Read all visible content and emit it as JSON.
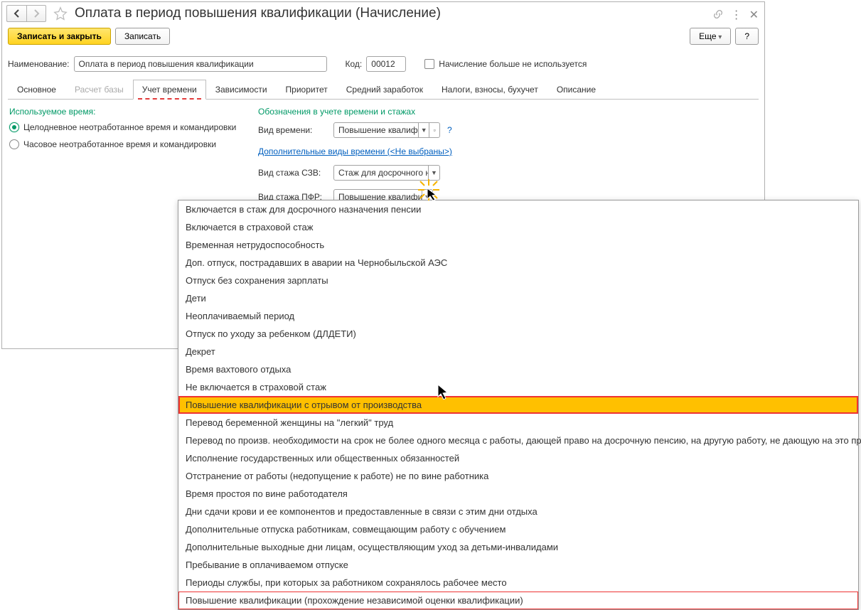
{
  "header": {
    "title": "Оплата в период повышения квалификации (Начисление)"
  },
  "toolbar": {
    "save_close": "Записать и закрыть",
    "save": "Записать",
    "more": "Еще",
    "help": "?"
  },
  "form": {
    "name_label": "Наименование:",
    "name_value": "Оплата в период повышения квалификации",
    "code_label": "Код:",
    "code_value": "00012",
    "not_used_label": "Начисление больше не используется"
  },
  "tabs": [
    {
      "label": "Основное",
      "active": false,
      "disabled": false
    },
    {
      "label": "Расчет базы",
      "active": false,
      "disabled": true
    },
    {
      "label": "Учет времени",
      "active": true,
      "disabled": false
    },
    {
      "label": "Зависимости",
      "active": false,
      "disabled": false
    },
    {
      "label": "Приоритет",
      "active": false,
      "disabled": false
    },
    {
      "label": "Средний заработок",
      "active": false,
      "disabled": false
    },
    {
      "label": "Налоги, взносы, бухучет",
      "active": false,
      "disabled": false
    },
    {
      "label": "Описание",
      "active": false,
      "disabled": false
    }
  ],
  "left": {
    "head": "Используемое время:",
    "radio1": "Целодневное неотработанное время и командировки",
    "radio2": "Часовое неотработанное время и командировки"
  },
  "right": {
    "head": "Обозначения в учете времени и стажах",
    "vid_vremeni_label": "Вид времени:",
    "vid_vremeni_value": "Повышение квалифика",
    "extra_link": "Дополнительные виды времени (<Не выбраны>)",
    "szv_label": "Вид стажа СЗВ:",
    "szv_value": "Стаж для досрочного на",
    "pfr_label": "Вид стажа ПФР:",
    "pfr_value": "Повышение квалифика"
  },
  "dropdown": [
    {
      "text": "Включается в стаж для досрочного назначения пенсии"
    },
    {
      "text": "Включается в страховой стаж"
    },
    {
      "text": "Временная нетрудоспособность"
    },
    {
      "text": "Доп. отпуск, пострадавших в аварии на Чернобыльской АЭС"
    },
    {
      "text": "Отпуск без сохранения зарплаты"
    },
    {
      "text": "Дети"
    },
    {
      "text": "Неоплачиваемый период"
    },
    {
      "text": "Отпуск по уходу за ребенком (ДЛДЕТИ)"
    },
    {
      "text": "Декрет"
    },
    {
      "text": "Время вахтового отдыха"
    },
    {
      "text": "Не включается в страховой стаж"
    },
    {
      "text": "Повышение квалификации с отрывом от производства",
      "highlight": true
    },
    {
      "text": "Перевод беременной женщины на \"легкий\" труд"
    },
    {
      "text": "Перевод по произв. необходимости на срок не более одного месяца с работы, дающей право на досрочную пенсию, на другую работу, не дающую на это право"
    },
    {
      "text": "Исполнение государственных или общественных обязанностей"
    },
    {
      "text": "Отстранение от работы (недопущение к работе) не по вине работника"
    },
    {
      "text": "Время простоя по вине работодателя"
    },
    {
      "text": "Дни сдачи крови и ее компонентов и предоставленные в связи с этим дни отдыха"
    },
    {
      "text": "Дополнительные отпуска работникам, совмещающим работу с обучением"
    },
    {
      "text": "Дополнительные выходные дни лицам, осуществляющим уход за детьми-инвалидами"
    },
    {
      "text": "Пребывание в оплачиваемом отпуске"
    },
    {
      "text": "Периоды службы, при которых за работником сохранялось рабочее место"
    },
    {
      "text": "Повышение квалификации (прохождение независимой оценки квалификации)",
      "boxed": true
    }
  ]
}
